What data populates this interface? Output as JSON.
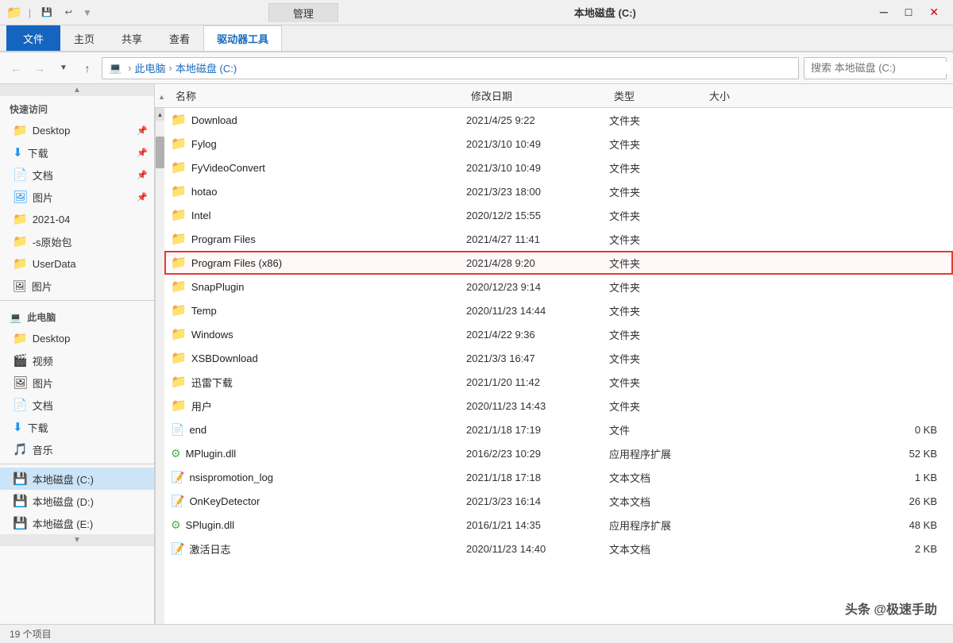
{
  "titleBar": {
    "title": "本地磁盘 (C:)",
    "manageLabel": "管理",
    "driveToolsLabel": "驱动器工具"
  },
  "ribbon": {
    "tabs": [
      {
        "label": "文件",
        "active": false,
        "blue": true
      },
      {
        "label": "主页",
        "active": false
      },
      {
        "label": "共享",
        "active": false
      },
      {
        "label": "查看",
        "active": false
      },
      {
        "label": "驱动器工具",
        "active": true
      }
    ]
  },
  "addressBar": {
    "back": "←",
    "forward": "→",
    "dropdown": "∨",
    "up": "↑",
    "pathParts": [
      "此电脑",
      "本地磁盘 (C:)"
    ],
    "searchPlaceholder": "搜索"
  },
  "columns": {
    "upArrow": "▲",
    "name": "名称",
    "date": "修改日期",
    "type": "类型",
    "size": "大小"
  },
  "files": [
    {
      "name": "Download",
      "date": "2021/4/25 9:22",
      "type": "文件夹",
      "size": "",
      "icon": "folder",
      "highlighted": false
    },
    {
      "name": "Fylog",
      "date": "2021/3/10 10:49",
      "type": "文件夹",
      "size": "",
      "icon": "folder",
      "highlighted": false
    },
    {
      "name": "FyVideoConvert",
      "date": "2021/3/10 10:49",
      "type": "文件夹",
      "size": "",
      "icon": "folder",
      "highlighted": false
    },
    {
      "name": "hotao",
      "date": "2021/3/23 18:00",
      "type": "文件夹",
      "size": "",
      "icon": "folder",
      "highlighted": false
    },
    {
      "name": "Intel",
      "date": "2020/12/2 15:55",
      "type": "文件夹",
      "size": "",
      "icon": "folder",
      "highlighted": false
    },
    {
      "name": "Program Files",
      "date": "2021/4/27 11:41",
      "type": "文件夹",
      "size": "",
      "icon": "folder",
      "highlighted": false
    },
    {
      "name": "Program Files (x86)",
      "date": "2021/4/28 9:20",
      "type": "文件夹",
      "size": "",
      "icon": "folder",
      "highlighted": true
    },
    {
      "name": "SnapPlugin",
      "date": "2020/12/23 9:14",
      "type": "文件夹",
      "size": "",
      "icon": "folder",
      "highlighted": false
    },
    {
      "name": "Temp",
      "date": "2020/11/23 14:44",
      "type": "文件夹",
      "size": "",
      "icon": "folder",
      "highlighted": false
    },
    {
      "name": "Windows",
      "date": "2021/4/22 9:36",
      "type": "文件夹",
      "size": "",
      "icon": "folder",
      "highlighted": false
    },
    {
      "name": "XSBDownload",
      "date": "2021/3/3 16:47",
      "type": "文件夹",
      "size": "",
      "icon": "folder",
      "highlighted": false
    },
    {
      "name": "迅雷下载",
      "date": "2021/1/20 11:42",
      "type": "文件夹",
      "size": "",
      "icon": "folder",
      "highlighted": false
    },
    {
      "name": "用户",
      "date": "2020/11/23 14:43",
      "type": "文件夹",
      "size": "",
      "icon": "folder",
      "highlighted": false
    },
    {
      "name": "end",
      "date": "2021/1/18 17:19",
      "type": "文件",
      "size": "0 KB",
      "icon": "file",
      "highlighted": false
    },
    {
      "name": "MPlugin.dll",
      "date": "2016/2/23 10:29",
      "type": "应用程序扩展",
      "size": "52 KB",
      "icon": "dll",
      "highlighted": false
    },
    {
      "name": "nsispromotion_log",
      "date": "2021/1/18 17:18",
      "type": "文本文档",
      "size": "1 KB",
      "icon": "txt",
      "highlighted": false
    },
    {
      "name": "OnKeyDetector",
      "date": "2021/3/23 16:14",
      "type": "文本文档",
      "size": "26 KB",
      "icon": "txt",
      "highlighted": false
    },
    {
      "name": "SPlugin.dll",
      "date": "2016/1/21 14:35",
      "type": "应用程序扩展",
      "size": "48 KB",
      "icon": "dll",
      "highlighted": false
    },
    {
      "name": "激活日志",
      "date": "2020/11/23 14:40",
      "type": "文本文档",
      "size": "2 KB",
      "icon": "txt",
      "highlighted": false
    }
  ],
  "sidebar": {
    "quickAccess": "快速访问",
    "items": [
      {
        "label": "Desktop",
        "icon": "folder-blue",
        "pinned": true,
        "active": false
      },
      {
        "label": "下载",
        "icon": "download",
        "pinned": true,
        "active": false
      },
      {
        "label": "文档",
        "icon": "doc",
        "pinned": true,
        "active": false
      },
      {
        "label": "图片",
        "icon": "picture",
        "pinned": true,
        "active": false
      },
      {
        "label": "2021-04",
        "icon": "folder-yellow",
        "pinned": false,
        "active": false
      },
      {
        "label": "-s原始包",
        "icon": "folder-yellow",
        "pinned": false,
        "active": false
      },
      {
        "label": "UserData",
        "icon": "folder-yellow",
        "pinned": false,
        "active": false
      },
      {
        "label": "图片",
        "icon": "picture-small",
        "pinned": false,
        "active": false
      }
    ],
    "thisPC": "此电脑",
    "drives": [
      {
        "label": "Desktop",
        "icon": "folder-blue",
        "active": false
      },
      {
        "label": "视频",
        "icon": "video",
        "active": false
      },
      {
        "label": "图片",
        "icon": "picture",
        "active": false
      },
      {
        "label": "文档",
        "icon": "doc",
        "active": false
      },
      {
        "label": "下载",
        "icon": "download",
        "active": false
      },
      {
        "label": "音乐",
        "icon": "music",
        "active": false
      },
      {
        "label": "本地磁盘 (C:)",
        "icon": "drive-c",
        "active": true
      },
      {
        "label": "本地磁盘 (D:)",
        "icon": "drive",
        "active": false
      },
      {
        "label": "本地磁盘 (E:)",
        "icon": "drive",
        "active": false
      }
    ]
  },
  "watermark": "头条 @极速手助"
}
